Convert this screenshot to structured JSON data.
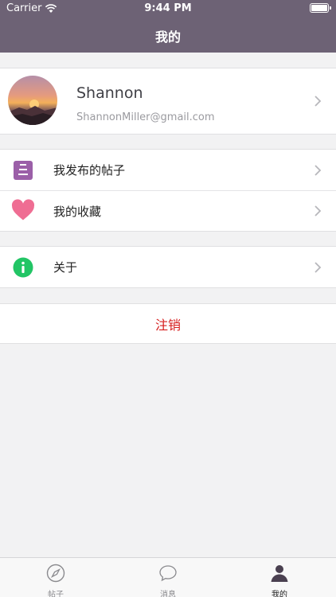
{
  "status_bar": {
    "carrier": "Carrier",
    "time": "9:44 PM"
  },
  "nav": {
    "title": "我的"
  },
  "profile": {
    "name": "Shannon",
    "email": "ShannonMiller@gmail.com"
  },
  "menu": [
    {
      "label": "我发布的帖子",
      "icon": "posts-icon"
    },
    {
      "label": "我的收藏",
      "icon": "heart-icon"
    },
    {
      "label": "关于",
      "icon": "info-icon"
    }
  ],
  "logout_label": "注销",
  "colors": {
    "nav_bg": "#6d6275",
    "logout_red": "#d61d1d",
    "posts_icon": "#9b5fa8",
    "heart_icon": "#ef6d93",
    "info_icon": "#22c565"
  },
  "tabs": [
    {
      "label": "帖子",
      "icon": "compass-icon",
      "active": false
    },
    {
      "label": "消息",
      "icon": "chat-bubble-icon",
      "active": false
    },
    {
      "label": "我的",
      "icon": "person-icon",
      "active": true
    }
  ]
}
